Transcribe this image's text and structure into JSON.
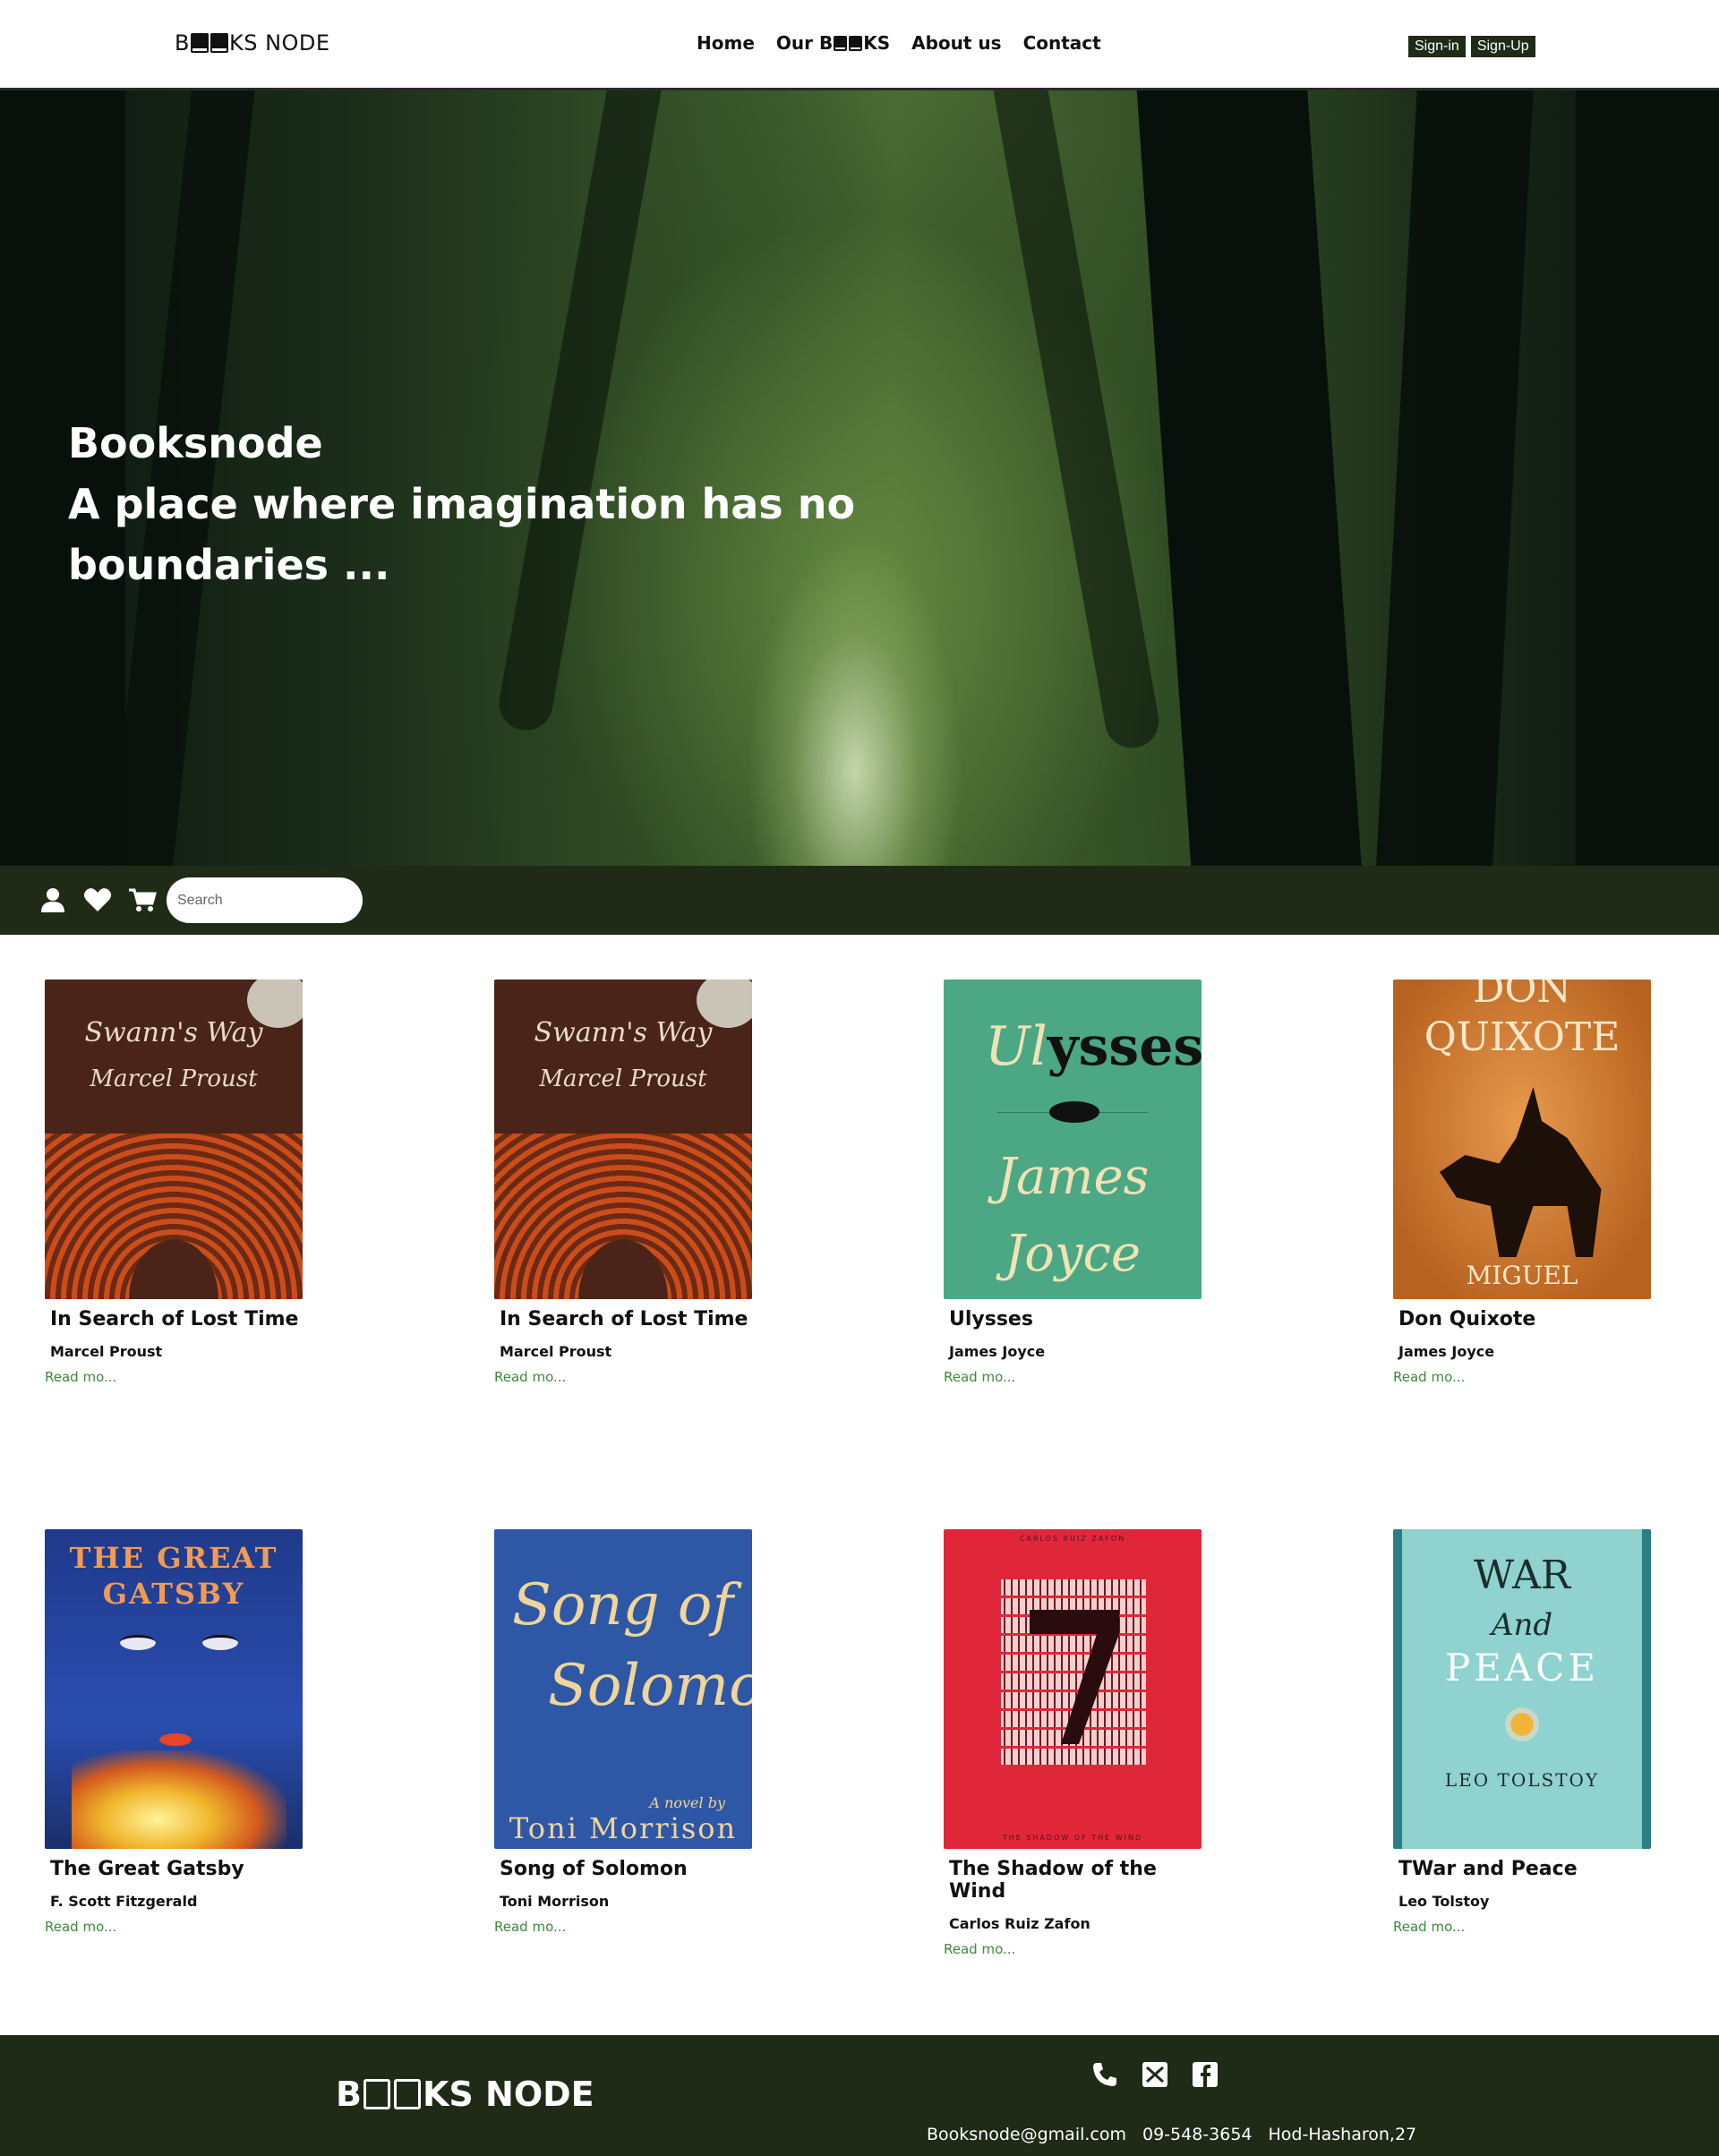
{
  "header": {
    "logo": {
      "prefix": "B",
      "suffix": "KS NODE"
    },
    "nav": [
      {
        "label": "Home"
      },
      {
        "label_prefix": "Our B",
        "label_suffix": "KS"
      },
      {
        "label": "About us"
      },
      {
        "label": "Contact"
      }
    ],
    "signin_label": "Sign-in",
    "signup_label": "Sign-Up"
  },
  "hero": {
    "line1": "Booksnode",
    "line2": "A place where imagination has no boundaries ..."
  },
  "toolbar": {
    "icons": [
      "user-icon",
      "heart-icon",
      "cart-icon"
    ],
    "search_placeholder": "Search"
  },
  "books": [
    {
      "title": "In Search of Lost Time",
      "author": "Marcel Proust",
      "more": "Read mo...",
      "cover": {
        "line1": "Swann's Way",
        "line2": "Marcel Proust"
      }
    },
    {
      "title": "In Search of Lost Time",
      "author": "Marcel Proust",
      "more": "Read mo...",
      "cover": {
        "line1": "Swann's Way",
        "line2": "Marcel Proust"
      }
    },
    {
      "title": "Ulysses",
      "author": "James Joyce",
      "more": "Read mo...",
      "cover": {
        "line1a": "Ul",
        "line1b": "ysses",
        "line2": "James",
        "line3": "Joyce"
      }
    },
    {
      "title": "Don Quixote",
      "author": "James Joyce",
      "more": "Read mo...",
      "cover": {
        "line1": "DON",
        "line2": "QUIXOTE",
        "line3": "MIGUEL"
      }
    },
    {
      "title": "The Great Gatsby",
      "author": "F. Scott Fitzgerald",
      "more": "Read mo...",
      "cover": {
        "line1": "THE GREAT",
        "line2": "GATSBY"
      }
    },
    {
      "title": "Song of Solomon",
      "author": "Toni Morrison",
      "more": "Read mo...",
      "cover": {
        "line1": "Song of",
        "line2": "Solomon",
        "line3": "A novel by",
        "line4": "Toni Morrison"
      }
    },
    {
      "title": "The Shadow of the Wind",
      "author": "Carlos Ruiz Zafon",
      "more": "Read mo...",
      "cover": {
        "top": "CARLOS RUIZ ZAFON",
        "bottom": "THE SHADOW OF THE WIND"
      }
    },
    {
      "title": "TWar and Peace",
      "author": "Leo Tolstoy",
      "more": "Read mo...",
      "cover": {
        "line1": "WAR",
        "line2": "And",
        "line3": "PEACE",
        "line4": "LEO TOLSTOY"
      }
    }
  ],
  "footer": {
    "logo": {
      "prefix": "B",
      "suffix": "KS NODE"
    },
    "icons": [
      "phone-icon",
      "mail-icon",
      "facebook-icon"
    ],
    "email": "Booksnode@gmail.com",
    "phone": "09-548-3654",
    "address": "Hod-Hasharon,27"
  },
  "colors": {
    "accent": "#1f2a17",
    "link": "#3c8a3c"
  }
}
